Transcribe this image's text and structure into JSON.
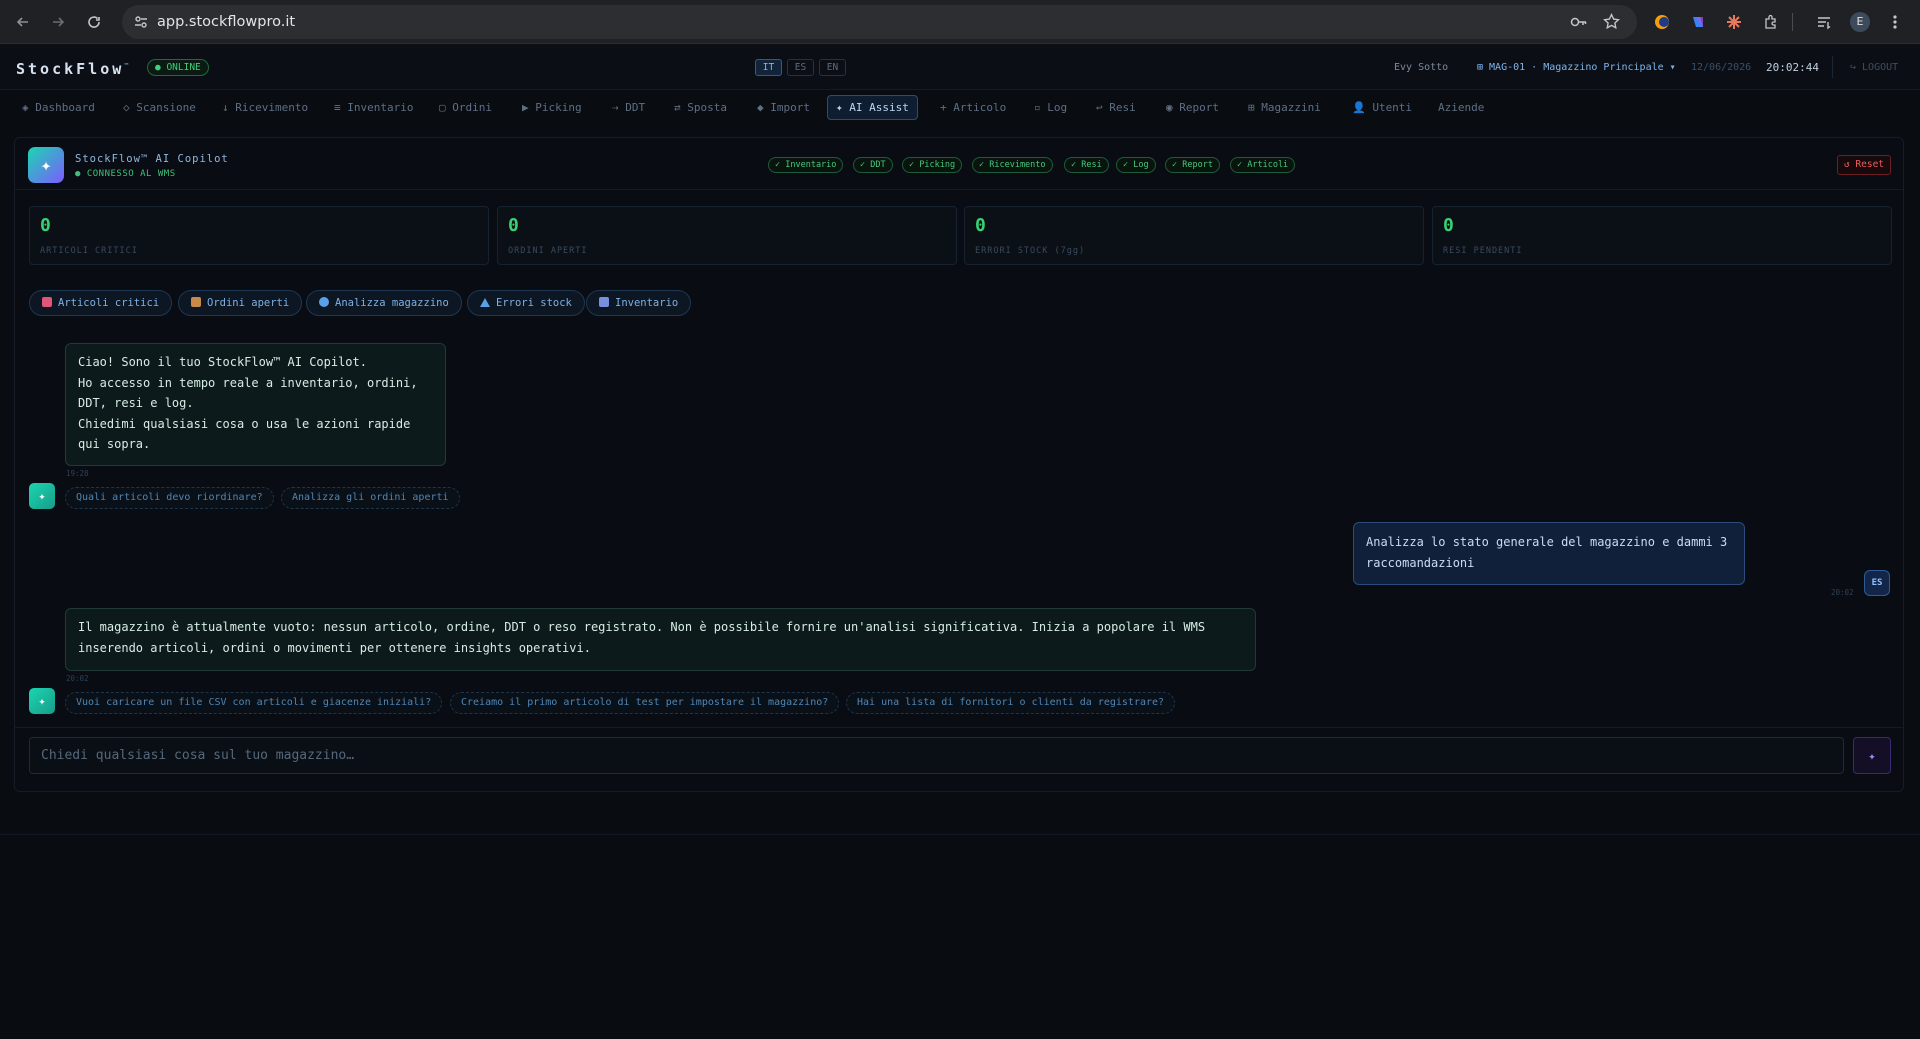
{
  "browser": {
    "url": "app.stockflowpro.it",
    "profile_initial": "E"
  },
  "header": {
    "brand": "StockFlow",
    "brand_tm": "™",
    "status": "● ONLINE",
    "languages": [
      "IT",
      "ES",
      "EN"
    ],
    "active_language": "IT",
    "user": "Evy Sotto",
    "warehouse": "⊞ MAG-01 · Magazzino Principale ▾",
    "date": "12/06/2026",
    "time": "20:02:44",
    "logout": "↪ LOGOUT"
  },
  "nav": {
    "tabs": [
      {
        "label": "◈ Dashboard"
      },
      {
        "label": "◇ Scansione"
      },
      {
        "label": "↓ Ricevimento"
      },
      {
        "label": "≡ Inventario"
      },
      {
        "label": "▢ Ordini"
      },
      {
        "label": "▶ Picking"
      },
      {
        "label": "⇢ DDT"
      },
      {
        "label": "⇄ Sposta"
      },
      {
        "label": "◆ Import"
      },
      {
        "label": "✦ AI Assist"
      },
      {
        "label": "+ Articolo"
      },
      {
        "label": "▫ Log"
      },
      {
        "label": "↩ Resi"
      },
      {
        "label": "◉ Report"
      },
      {
        "label": "⊞ Magazzini"
      },
      {
        "label": "👤 Utenti"
      },
      {
        "label": "Aziende"
      }
    ],
    "active": "✦ AI Assist"
  },
  "copilot": {
    "title": "StockFlow™ AI Copilot",
    "subtitle": "● CONNESSO AL WMS",
    "modules": [
      "✓ Inventario",
      "✓ DDT",
      "✓ Picking",
      "✓ Ricevimento",
      "✓ Resi",
      "✓ Log",
      "✓ Report",
      "✓ Articoli"
    ],
    "reset": "↺ Reset",
    "stats": [
      {
        "value": "0",
        "label": "ARTICOLI CRITICI"
      },
      {
        "value": "0",
        "label": "ORDINI APERTI"
      },
      {
        "value": "0",
        "label": "ERRORI STOCK (7gg)"
      },
      {
        "value": "0",
        "label": "RESI PENDENTI"
      }
    ],
    "quick_actions": [
      {
        "label": "Articoli critici",
        "icon": "chart-icon",
        "color": "#e0567a"
      },
      {
        "label": "Ordini aperti",
        "icon": "package-icon",
        "color": "#c9894a"
      },
      {
        "label": "Analizza magazzino",
        "icon": "magnifier-icon",
        "color": "#5aa0e8"
      },
      {
        "label": "Errori stock",
        "icon": "warning-icon",
        "color": "#5aa0e8"
      },
      {
        "label": "Inventario",
        "icon": "clipboard-icon",
        "color": "#7b8fe0"
      }
    ]
  },
  "chat": {
    "messages": [
      {
        "role": "assistant",
        "text": "Ciao! Sono il tuo StockFlow™ AI Copilot.\nHo accesso in tempo reale a inventario, ordini,\nDDT, resi e log.\nChiedimi qualsiasi cosa o usa le azioni rapide\nqui sopra.",
        "time": "19:28",
        "suggestions": [
          "Quali articoli devo riordinare?",
          "Analizza gli ordini aperti"
        ]
      },
      {
        "role": "user",
        "text": "Analizza lo stato generale del magazzino e dammi 3\nraccomandazioni",
        "time": "20:02",
        "avatar": "ES"
      },
      {
        "role": "assistant",
        "text": "Il magazzino è attualmente vuoto: nessun articolo, ordine, DDT o reso registrato. Non è possibile fornire un'analisi significativa. Inizia a popolare il WMS\ninserendo articoli, ordini o movimenti per ottenere insights operativi.",
        "time": "20:02",
        "suggestions": [
          "Vuoi caricare un file CSV con articoli e giacenze iniziali?",
          "Creiamo il primo articolo di test per impostare il magazzino?",
          "Hai una lista di fornitori o clienti da registrare?"
        ]
      }
    ],
    "input_placeholder": "Chiedi qualsiasi cosa sul tuo magazzino…",
    "send_icon": "✦"
  },
  "colors": {
    "background": "#090c11",
    "accent_teal": "#1bd6b0",
    "accent_blue": "#7fb4ec",
    "ok_green": "#39cf72",
    "danger": "#ef5b5b"
  }
}
